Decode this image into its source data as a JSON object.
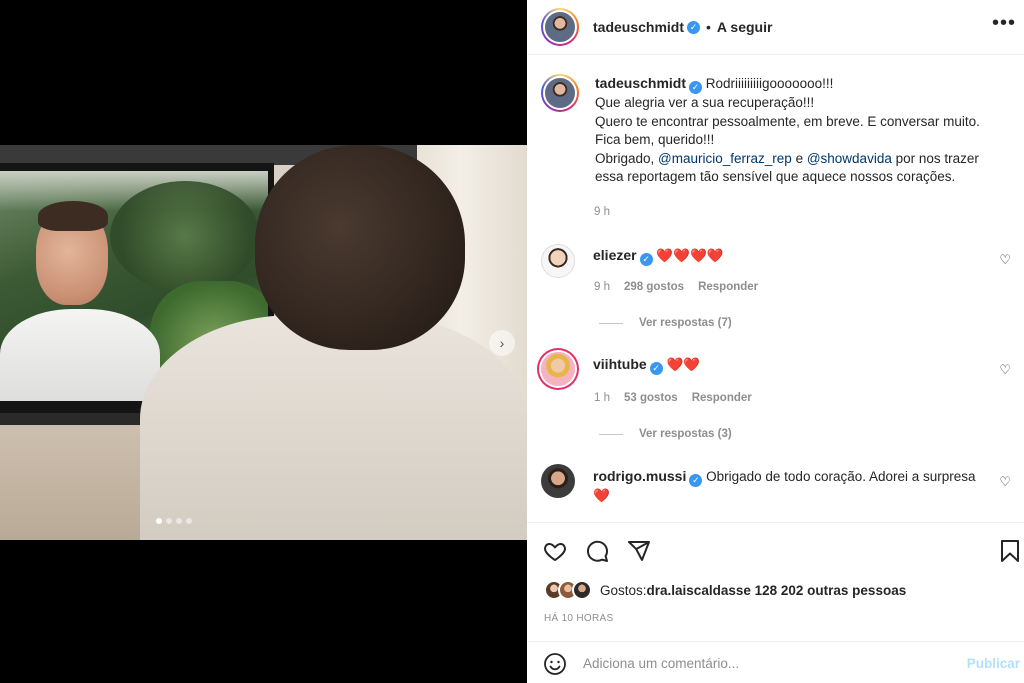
{
  "post": {
    "username": "tadeuschmidt",
    "follow_label": "A seguir",
    "more_icon": "more-options-icon",
    "caption_lines": [
      "Rodriiiiiiiiigooooooo!!!",
      "Que alegria ver a sua recuperação!!!",
      "Quero te encontrar pessoalmente, em breve. E conversar muito.",
      "Fica bem, querido!!!"
    ],
    "caption_thanks_prefix": "Obrigado, ",
    "mention_1": "@mauricio_ferraz_rep",
    "caption_and": " e ",
    "mention_2": "@showdavida",
    "caption_thanks_suffix": " por nos trazer",
    "caption_last": "essa reportagem tão sensível que aquece nossos corações.",
    "time": "9 h"
  },
  "comments": [
    {
      "username": "eliezer",
      "text": "❤️❤️❤️❤️",
      "time": "9 h",
      "likes": "298 gostos",
      "reply": "Responder",
      "view_replies": "Ver respostas (7)"
    },
    {
      "username": "viihtube",
      "text": "❤️❤️",
      "time": "1 h",
      "likes": "53 gostos",
      "reply": "Responder",
      "view_replies": "Ver respostas (3)"
    },
    {
      "username": "rodrigo.mussi",
      "text": "Obrigado de todo coração. Adorei a surpresa",
      "text_line2": "❤️"
    }
  ],
  "actions": {
    "likes_prefix": "Gostos: ",
    "likes_user": "dra.laiscaldass",
    "likes_suffix": " e 128 202 outras pessoas",
    "timestamp": "HÁ 10 HORAS",
    "comment_placeholder": "Adiciona um comentário...",
    "publish_label": "Publicar"
  },
  "colors": {
    "accent": "#3897f0",
    "heart_red": "#ed4956",
    "muted": "#8e8e8e",
    "mention": "#00376b"
  },
  "carousel": {
    "slides": 4,
    "current": 1
  }
}
